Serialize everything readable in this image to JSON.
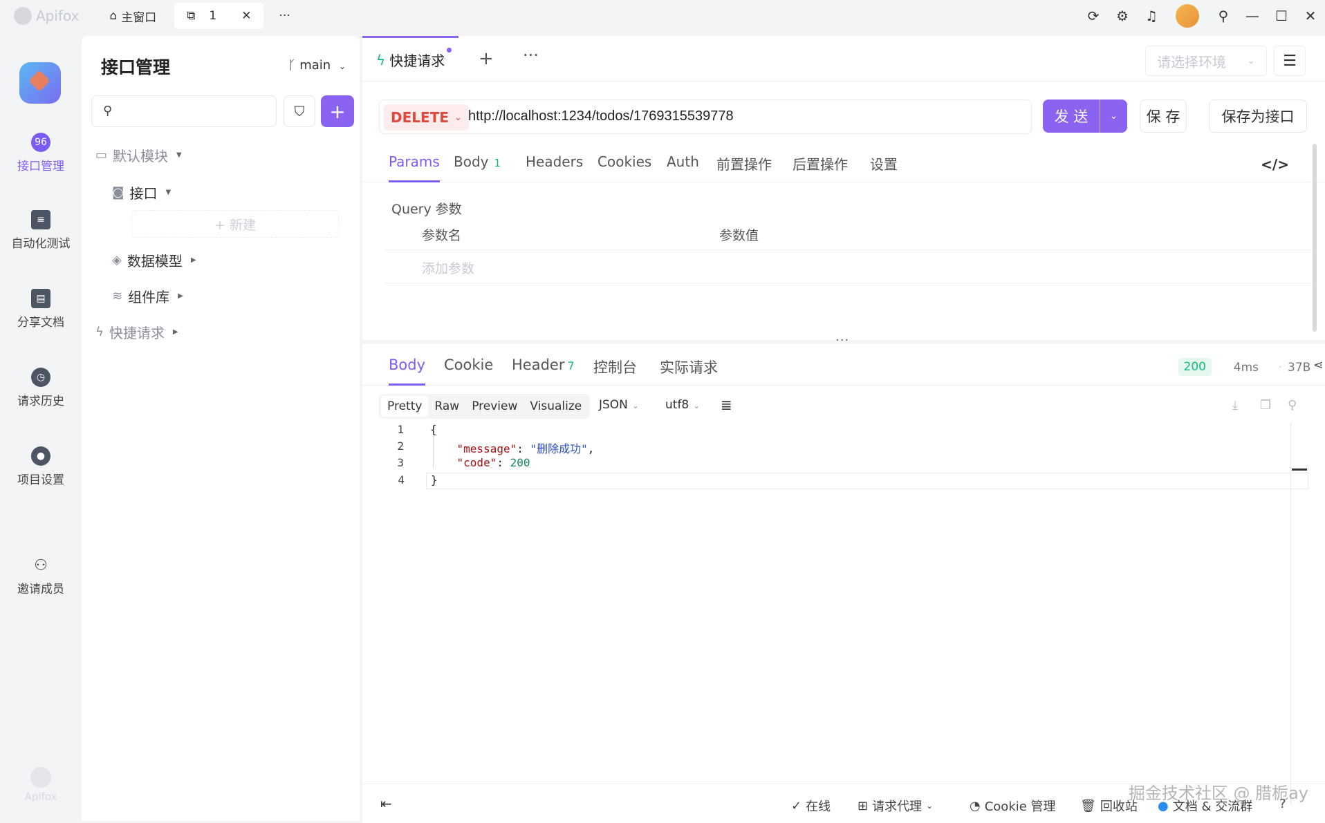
{
  "titlebar": {
    "app_name": "Apifox",
    "home_tab": "主窗口",
    "current_tab": "1",
    "more": "···"
  },
  "rail": {
    "items": [
      {
        "label": "接口管理",
        "icon": "api-icon"
      },
      {
        "label": "自动化测试",
        "icon": "test-icon"
      },
      {
        "label": "分享文档",
        "icon": "doc-icon"
      },
      {
        "label": "请求历史",
        "icon": "clock-icon"
      },
      {
        "label": "项目设置",
        "icon": "settings-icon"
      },
      {
        "label": "邀请成员",
        "icon": "invite-icon"
      }
    ],
    "brand": "Apifox"
  },
  "sidebar": {
    "title": "接口管理",
    "branch": "main",
    "tree": {
      "default_module": "默认模块",
      "api": "接口",
      "new": "+ 新建",
      "data_model": "数据模型",
      "components": "组件库",
      "quick_request": "快捷请求"
    }
  },
  "main": {
    "tab_title": "快捷请求",
    "env_placeholder": "请选择环境",
    "method": "DELETE",
    "url": "http://localhost:1234/todos/1769315539778",
    "send": "发 送",
    "save": "保 存",
    "save_as_api": "保存为接口",
    "request_tabs": [
      {
        "label": "Params"
      },
      {
        "label": "Body",
        "badge": "1"
      },
      {
        "label": "Headers"
      },
      {
        "label": "Cookies"
      },
      {
        "label": "Auth"
      },
      {
        "label": "前置操作"
      },
      {
        "label": "后置操作"
      },
      {
        "label": "设置"
      }
    ],
    "query_label": "Query 参数",
    "param_name_col": "参数名",
    "param_value_col": "参数值",
    "add_param_placeholder": "添加参数"
  },
  "response": {
    "tabs": [
      {
        "label": "Body"
      },
      {
        "label": "Cookie"
      },
      {
        "label": "Header",
        "badge": "7"
      },
      {
        "label": "控制台"
      },
      {
        "label": "实际请求"
      }
    ],
    "status": "200",
    "time": "4ms",
    "size": "37B",
    "formats": [
      "Pretty",
      "Raw",
      "Preview",
      "Visualize"
    ],
    "content_type": "JSON",
    "encoding": "utf8",
    "code_lines": [
      {
        "n": "1"
      },
      {
        "n": "2",
        "key": "\"message\"",
        "value": "\"删除成功\""
      },
      {
        "n": "3",
        "key": "\"code\"",
        "value": "200"
      },
      {
        "n": "4"
      }
    ]
  },
  "footer": {
    "online": "在线",
    "proxy": "请求代理",
    "cookie_mgmt": "Cookie 管理",
    "recycle": "回收站",
    "docs": "文档 & 交流群"
  },
  "watermark": "掘金技术社区 @ 腊栀ay"
}
